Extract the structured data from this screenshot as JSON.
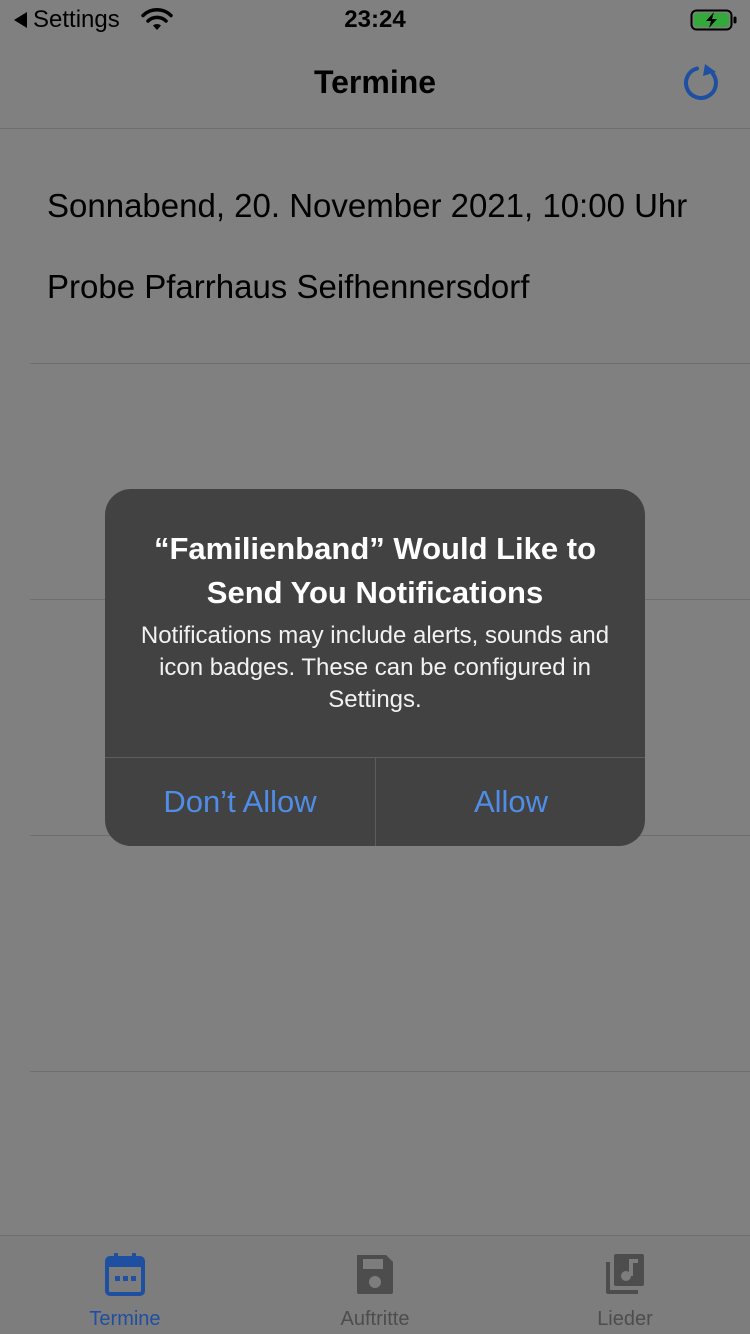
{
  "status_bar": {
    "back_label": "Settings",
    "time": "23:24",
    "icons": [
      "back-arrow-icon",
      "wifi-icon",
      "battery-charging-icon"
    ]
  },
  "nav": {
    "title": "Termine",
    "refresh_icon": "refresh-icon"
  },
  "list": {
    "items": [
      {
        "date": "Sonnabend, 20. November 2021, 10:00 Uhr",
        "title": "Probe Pfarrhaus Seifhennersdorf"
      }
    ]
  },
  "alert": {
    "title": "“Familienband” Would Like to Send You Notifications",
    "message": "Notifications may include alerts, sounds and icon badges. These can be configured in Settings.",
    "deny_label": "Don’t Allow",
    "allow_label": "Allow"
  },
  "tabs": [
    {
      "label": "Termine",
      "icon": "calendar-icon",
      "active": true
    },
    {
      "label": "Auftritte",
      "icon": "save-icon",
      "active": false
    },
    {
      "label": "Lieder",
      "icon": "music-library-icon",
      "active": false
    }
  ],
  "colors": {
    "dimmed_background": "#808080",
    "accent": "#1f4fa0",
    "alert_button": "#4f8de6",
    "tab_inactive": "#4d4d4d"
  }
}
